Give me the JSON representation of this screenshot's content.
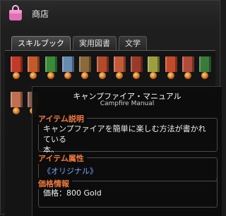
{
  "window": {
    "title": "商店"
  },
  "tabs": [
    {
      "label": "スキルブック",
      "active": true
    },
    {
      "label": "実用図書",
      "active": false
    },
    {
      "label": "文学",
      "active": false
    }
  ],
  "items": [
    {
      "color": "#c23a2a"
    },
    {
      "color": "#c45a2a"
    },
    {
      "color": "#3a8a3a"
    },
    {
      "color": "#6a8ab0"
    },
    {
      "color": "#8a6a3a"
    },
    {
      "color": "#b04a2a"
    },
    {
      "color": "#c05a3a"
    },
    {
      "color": "#9a3a2a"
    },
    {
      "color": "#9aa040"
    },
    {
      "color": "#c04a2a"
    },
    {
      "color": "#b04a3a"
    },
    {
      "color": "#3a7a3a"
    },
    {
      "color": "#c07050"
    },
    {
      "color": "#8a5a4a"
    }
  ],
  "tooltip": {
    "name": "キャンプファイア・マニュアル",
    "name_en": "Campfire Manual",
    "desc_head": "アイテム説明",
    "desc_line1": "キャンプファイアを簡単に楽しむ方法が書かれている",
    "desc_line2": "本。",
    "attr_head": "アイテム属性",
    "attr_value": "《オリジナル》",
    "price_head": "価格情報",
    "price_value": "価格：800 Gold"
  },
  "colors": {
    "accent": "#f07a3a",
    "attr": "#6fa8ff"
  }
}
